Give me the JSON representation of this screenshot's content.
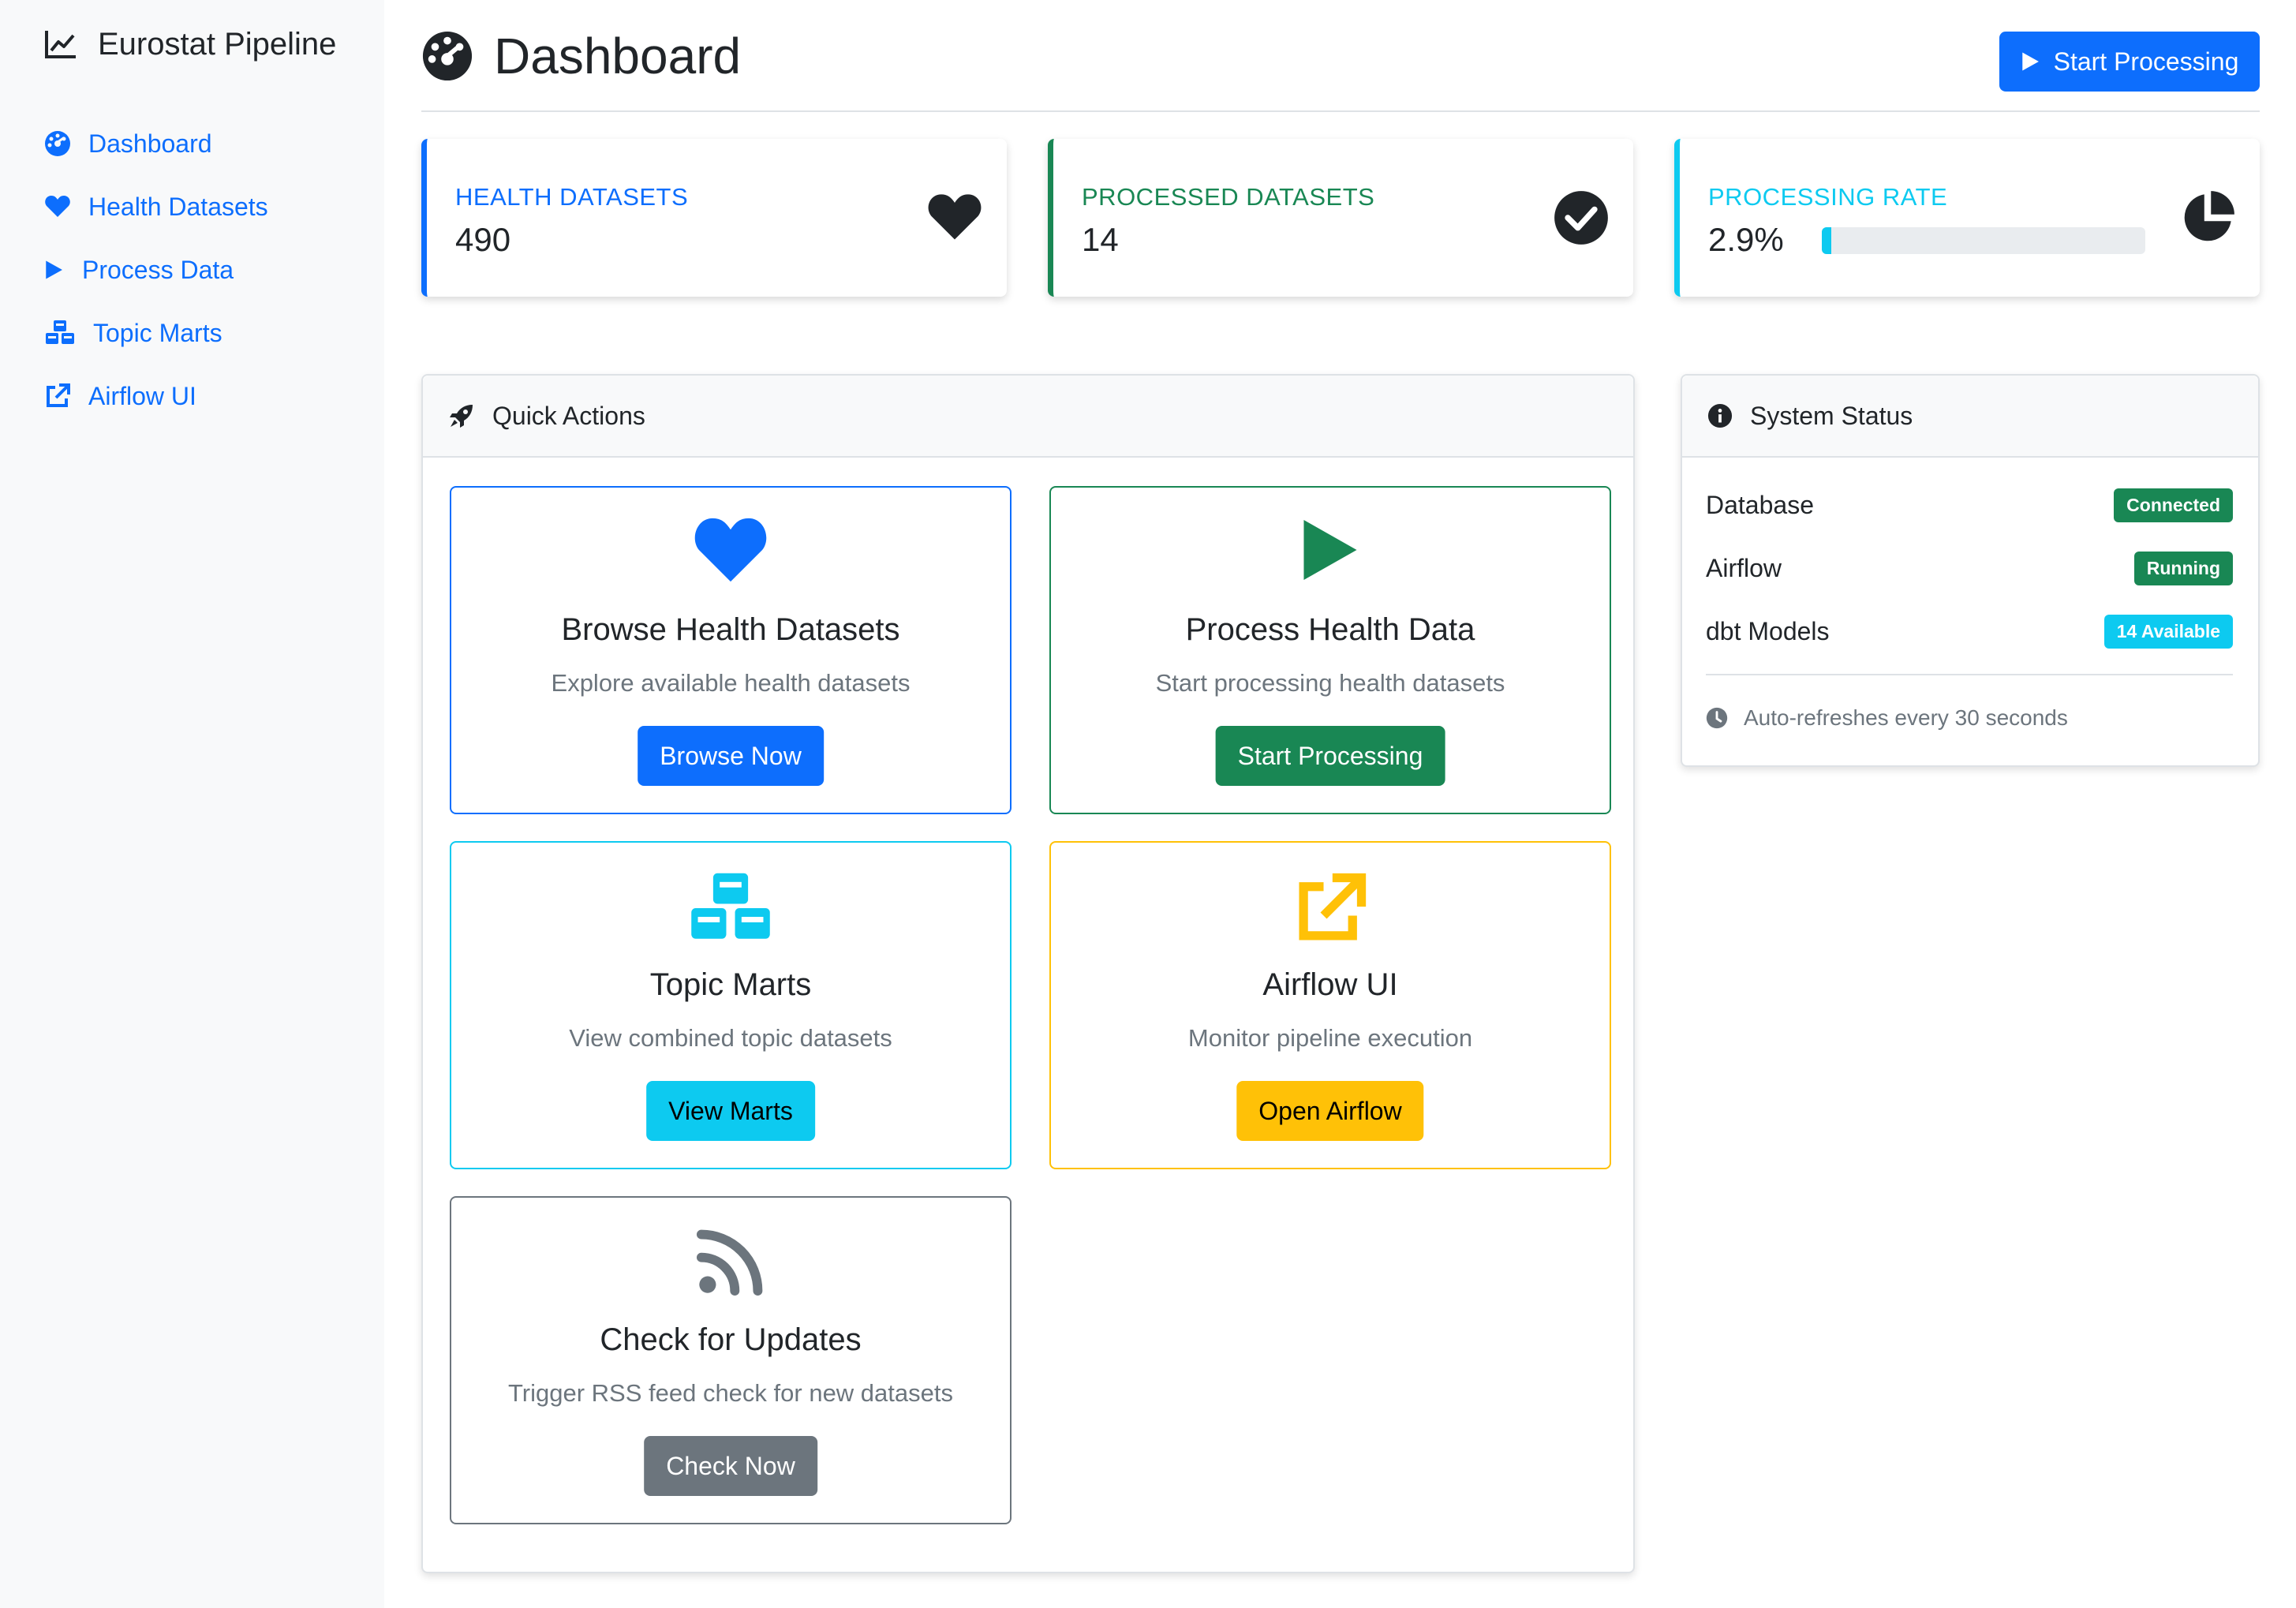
{
  "app": {
    "title": "Eurostat Pipeline"
  },
  "sidebar": {
    "items": [
      {
        "label": "Dashboard",
        "icon": "dashboard-gauge-icon"
      },
      {
        "label": "Health Datasets",
        "icon": "heart-icon"
      },
      {
        "label": "Process Data",
        "icon": "play-icon"
      },
      {
        "label": "Topic Marts",
        "icon": "cubes-icon"
      },
      {
        "label": "Airflow UI",
        "icon": "external-link-icon"
      }
    ]
  },
  "header": {
    "title": "Dashboard",
    "action_label": "Start Processing"
  },
  "stats": [
    {
      "label": "HEALTH DATASETS",
      "value": "490",
      "icon": "heart-icon",
      "color": "#0d6efd"
    },
    {
      "label": "PROCESSED DATASETS",
      "value": "14",
      "icon": "check-circle-icon",
      "color": "#198754"
    },
    {
      "label": "PROCESSING RATE",
      "value": "2.9%",
      "icon": "pie-chart-icon",
      "color": "#0dcaf0",
      "progress": 2.9
    }
  ],
  "quick_actions": {
    "title": "Quick Actions",
    "items": [
      {
        "title": "Browse Health Datasets",
        "desc": "Explore available health datasets",
        "button": "Browse Now",
        "color": "#0d6efd",
        "icon": "heart-icon"
      },
      {
        "title": "Process Health Data",
        "desc": "Start processing health datasets",
        "button": "Start Processing",
        "color": "#198754",
        "icon": "play-icon"
      },
      {
        "title": "Topic Marts",
        "desc": "View combined topic datasets",
        "button": "View Marts",
        "color": "#0dcaf0",
        "icon": "cubes-icon"
      },
      {
        "title": "Airflow UI",
        "desc": "Monitor pipeline execution",
        "button": "Open Airflow",
        "color": "#ffc107",
        "icon": "external-link-icon"
      },
      {
        "title": "Check for Updates",
        "desc": "Trigger RSS feed check for new datasets",
        "button": "Check Now",
        "color": "#6c757d",
        "icon": "rss-icon"
      }
    ]
  },
  "system_status": {
    "title": "System Status",
    "rows": [
      {
        "label": "Database",
        "badge": "Connected",
        "color": "#198754"
      },
      {
        "label": "Airflow",
        "badge": "Running",
        "color": "#198754"
      },
      {
        "label": "dbt Models",
        "badge": "14 Available",
        "color": "#0dcaf0"
      }
    ],
    "footer": "Auto-refreshes every 30 seconds"
  }
}
